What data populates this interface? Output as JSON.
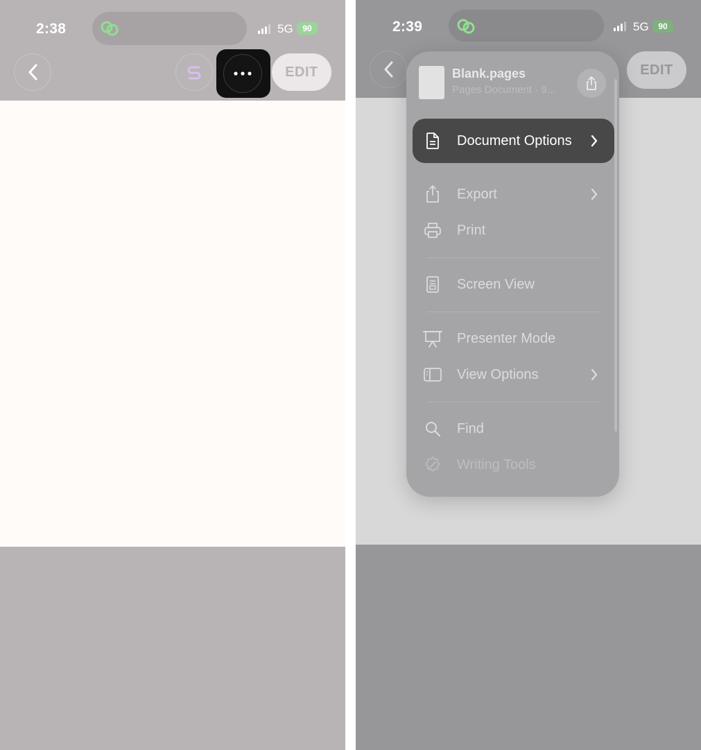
{
  "left": {
    "status": {
      "time": "2:38",
      "network": "5G",
      "battery": "90"
    },
    "nav": {
      "edit_label": "EDIT"
    }
  },
  "right": {
    "status": {
      "time": "2:39",
      "network": "5G",
      "battery": "90"
    },
    "nav": {
      "edit_label": "EDIT"
    },
    "menu": {
      "doc_title": "Blank.pages",
      "doc_subtitle": "Pages Document · 9...",
      "items": [
        {
          "label": "Document Options",
          "icon": "document-icon",
          "submenu": true,
          "highlighted": true
        },
        {
          "label": "Export",
          "icon": "export-icon",
          "submenu": true
        },
        {
          "label": "Print",
          "icon": "printer-icon",
          "submenu": false
        },
        {
          "label": "Screen View",
          "icon": "screen-view-icon",
          "submenu": false
        },
        {
          "label": "Presenter Mode",
          "icon": "presenter-icon",
          "submenu": false
        },
        {
          "label": "View Options",
          "icon": "sidebar-icon",
          "submenu": true
        },
        {
          "label": "Find",
          "icon": "search-icon",
          "submenu": false
        },
        {
          "label": "Writing Tools",
          "icon": "writing-tools-icon",
          "submenu": false,
          "disabled": true
        }
      ]
    }
  },
  "colors": {
    "highlight": "#111111",
    "active_menu_item": "#494849",
    "battery": "#9bd49b",
    "island_icon": "#8fe08f"
  }
}
